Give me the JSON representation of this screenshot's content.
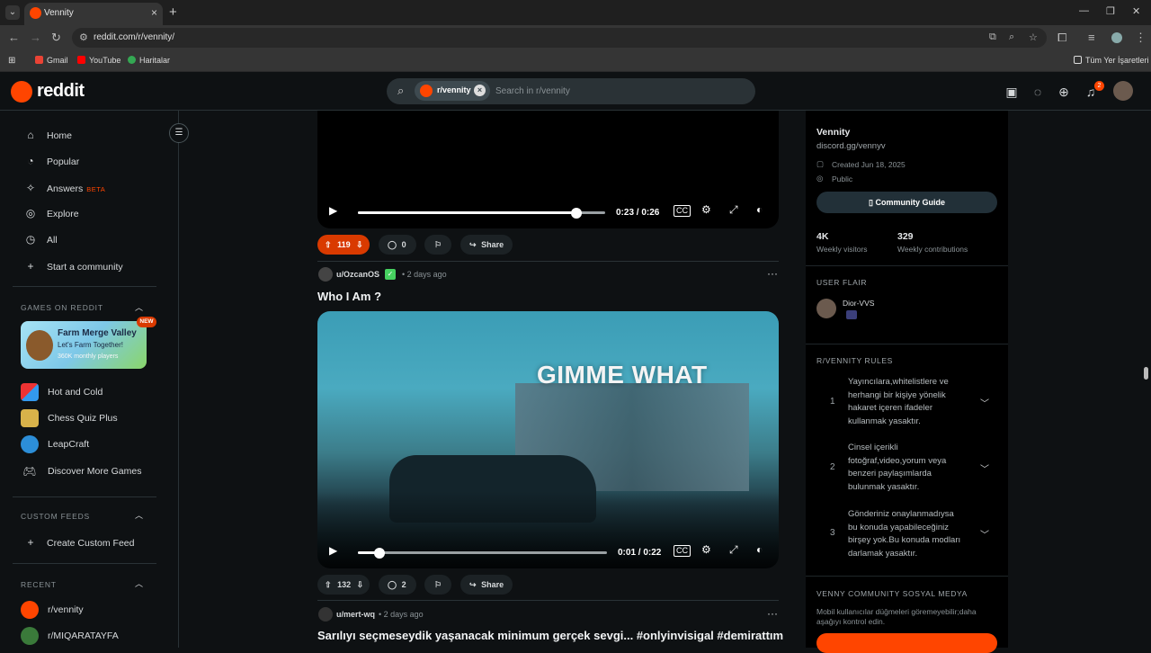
{
  "browser": {
    "tab_title": "Vennity",
    "url": "reddit.com/r/vennity/",
    "bookmarks": [
      "Gmail",
      "YouTube",
      "Haritalar"
    ],
    "all_bookmarks": "Tüm Yer İşaretleri"
  },
  "header": {
    "logo_text": "reddit",
    "search_chip": "r/vennity",
    "search_placeholder": "Search in r/vennity",
    "notification_count": "2"
  },
  "left_nav": {
    "items": [
      {
        "label": "Home",
        "icon": "home-icon"
      },
      {
        "label": "Popular",
        "icon": "popular-icon"
      },
      {
        "label": "Answers",
        "icon": "answers-icon",
        "badge": "BETA"
      },
      {
        "label": "Explore",
        "icon": "explore-icon"
      },
      {
        "label": "All",
        "icon": "all-icon"
      },
      {
        "label": "Start a community",
        "icon": "plus-icon"
      }
    ],
    "games_section": "GAMES ON REDDIT",
    "featured_game": {
      "title": "Farm Merge Valley",
      "subtitle": "Let's Farm Together!",
      "players": "360K monthly players",
      "badge": "NEW"
    },
    "games": [
      "Hot and Cold",
      "Chess Quiz Plus",
      "LeapCraft",
      "Discover More Games"
    ],
    "custom_feeds_section": "CUSTOM FEEDS",
    "create_custom_feed": "Create Custom Feed",
    "recent_section": "RECENT",
    "recent": [
      "r/vennity",
      "r/MIQARATAYFA"
    ]
  },
  "feed": {
    "post1": {
      "video_time": "0:23 / 0:26",
      "progress": 0.885,
      "upvotes": "119",
      "comments": "0",
      "share": "Share"
    },
    "post2": {
      "user": "u/OzcanOS",
      "age": "• 2 days ago",
      "title": "Who I Am ?",
      "video_overlay_text": "GIMME WHAT",
      "video_time": "0:01 / 0:22",
      "progress": 0.085,
      "upvotes": "132",
      "comments": "2",
      "share": "Share"
    },
    "post3": {
      "user": "u/mert-wq",
      "age": "• 2 days ago",
      "title": "Sarılıyı seçmeseydik yaşanacak minimum gerçek sevgi... #onlyinvisigal #demirattım"
    }
  },
  "community": {
    "name": "Vennity",
    "link": "discord.gg/vennyv",
    "created": "Created Jun 18, 2025",
    "visibility": "Public",
    "guide_button": "Community Guide",
    "weekly_visitors_value": "4K",
    "weekly_visitors_label": "Weekly visitors",
    "weekly_contrib_value": "329",
    "weekly_contrib_label": "Weekly contributions",
    "user_flair_section": "USER FLAIR",
    "user_flair_name": "Dior-VVS",
    "rules_section": "R/VENNITY RULES",
    "rules": [
      {
        "num": "1",
        "text": "Yayıncılara,whitelistlere ve herhangi bir kişiye yönelik hakaret içeren ifadeler kullanmak yasaktır."
      },
      {
        "num": "2",
        "text": "Cinsel içerikli fotoğraf,video,yorum veya benzeri paylaşımlarda bulunmak yasaktır."
      },
      {
        "num": "3",
        "text": "Gönderiniz onaylanmadıysa bu konuda yapabileceğiniz birşey yok.Bu konuda modları darlamak yasaktır."
      }
    ],
    "social_section": "VENNY COMMUNITY SOSYAL MEDYA",
    "social_note": "Mobil kullanıcılar düğmeleri göremeyebilir;daha aşağıyı kontrol edin."
  }
}
